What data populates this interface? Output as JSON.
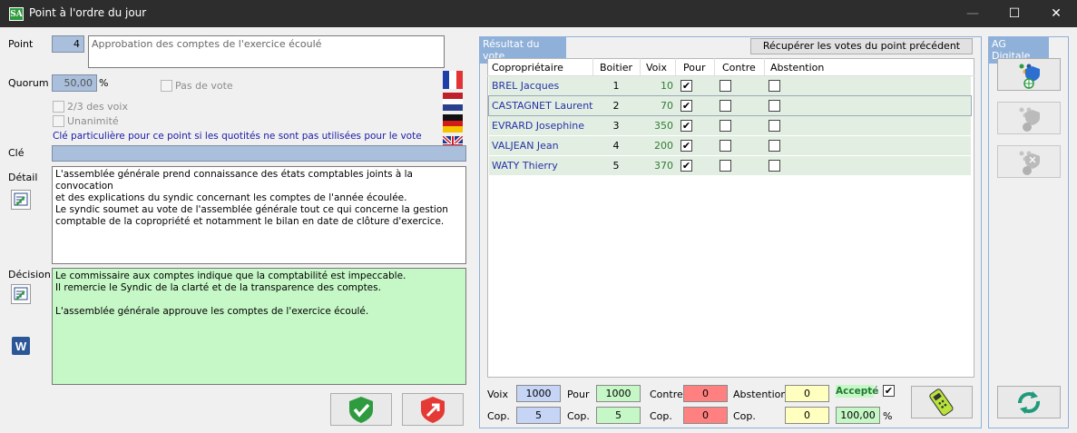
{
  "window": {
    "title": "Point à l'ordre du jour",
    "app_icon": "SA",
    "minimize": "—",
    "maximize": "☐",
    "close": "✕"
  },
  "form": {
    "point_label": "Point",
    "point_number": "4",
    "point_title": "Approbation des comptes de l'exercice écoulé",
    "quorum_label": "Quorum",
    "quorum_value": "50,00",
    "quorum_unit": "%",
    "pas_de_vote": "Pas de vote",
    "deux_tiers": "2/3 des voix",
    "unanimite": "Unanimité",
    "cle_hint": "Clé particulière pour ce point si les quotités ne sont pas utilisées pour le vote",
    "cle_label": "Clé",
    "cle_value": "",
    "detail_label": "Détail",
    "detail_text": "L'assemblée générale prend connaissance des états comptables joints à la convocation\net des explications du syndic concernant les comptes de l'année écoulée.\nLe syndic soumet au vote de l'assemblée générale tout ce qui concerne la gestion\ncomptable de la copropriété et notamment le bilan en date de clôture d'exercice.",
    "decision_label": "Décision",
    "decision_text": "Le commissaire aux comptes indique que la comptabilité est impeccable.\nIl remercie le Syndic de la clarté et de la transparence des comptes.\n\nL'assemblée générale approuve les comptes de l'exercice écoulé."
  },
  "flags": [
    "flag-france",
    "flag-netherlands",
    "flag-germany",
    "flag-uk"
  ],
  "vote": {
    "title": "Résultat du vote",
    "recup_button": "Récupérer les votes du point précédent",
    "headers": {
      "owner": "Copropriétaire",
      "boitier": "Boitier",
      "voix": "Voix",
      "pour": "Pour",
      "contre": "Contre",
      "abstention": "Abstention"
    },
    "rows": [
      {
        "owner": "BREL Jacques",
        "boitier": "1",
        "voix": "10",
        "pour": true,
        "contre": false,
        "abstention": false
      },
      {
        "owner": "CASTAGNET Laurent",
        "boitier": "2",
        "voix": "70",
        "pour": true,
        "contre": false,
        "abstention": false
      },
      {
        "owner": "EVRARD Josephine",
        "boitier": "3",
        "voix": "350",
        "pour": true,
        "contre": false,
        "abstention": false
      },
      {
        "owner": "VALJEAN Jean",
        "boitier": "4",
        "voix": "200",
        "pour": true,
        "contre": false,
        "abstention": false
      },
      {
        "owner": "WATY Thierry",
        "boitier": "5",
        "voix": "370",
        "pour": true,
        "contre": false,
        "abstention": false
      }
    ],
    "summary": {
      "voix_label": "Voix",
      "voix_value": "1000",
      "cop_label": "Cop.",
      "cop_value": "5",
      "pour_label": "Pour",
      "pour_voix": "1000",
      "pour_cop_label": "Cop.",
      "pour_cop": "5",
      "contre_label": "Contre",
      "contre_voix": "0",
      "contre_cop_label": "Cop.",
      "contre_cop": "0",
      "abst_label": "Abstention",
      "abst_voix": "0",
      "abst_cop_label": "Cop.",
      "abst_cop": "0",
      "accepte_label": "Accepté",
      "percent_value": "100,00",
      "percent_unit": "%"
    }
  },
  "ag_digitale": {
    "title": "AG Digitale"
  },
  "colors": {
    "accent": "#8fb0d8",
    "ok_green": "#2e9b3e",
    "cancel_red": "#e53935"
  }
}
